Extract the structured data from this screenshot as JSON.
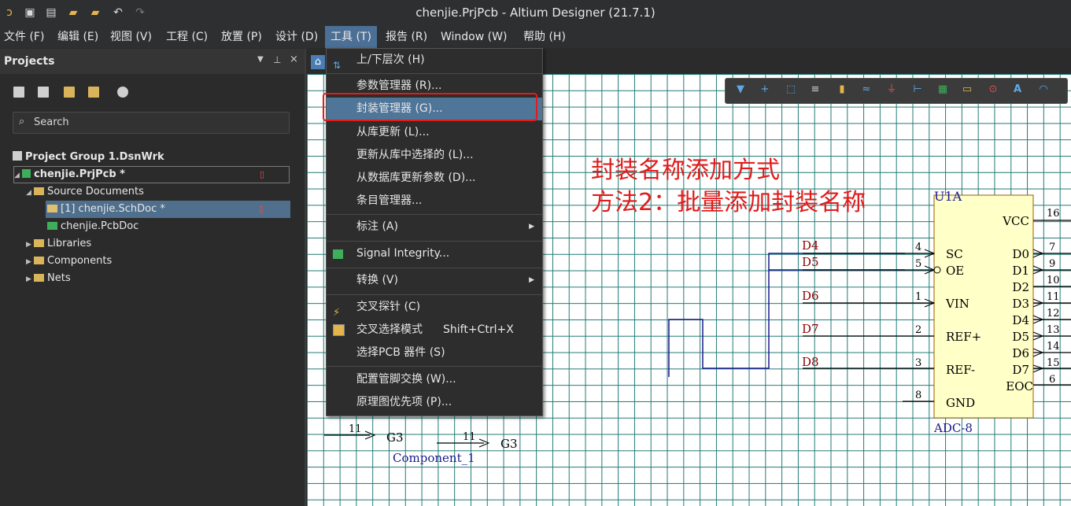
{
  "window": {
    "title": "chenjie.PrjPcb - Altium Designer (21.7.1)"
  },
  "menubar": {
    "items": [
      {
        "label": "文件 (F)"
      },
      {
        "label": "编辑 (E)"
      },
      {
        "label": "视图 (V)"
      },
      {
        "label": "工程 (C)"
      },
      {
        "label": "放置 (P)"
      },
      {
        "label": "设计 (D)"
      },
      {
        "label": "工具 (T)"
      },
      {
        "label": "报告 (R)"
      },
      {
        "label": "Window (W)"
      },
      {
        "label": "帮助 (H)"
      }
    ]
  },
  "panel": {
    "title": "Projects",
    "search_placeholder": "Search",
    "tree": {
      "group": "Project Group 1.DsnWrk",
      "project": "chenjie.PrjPcb *",
      "source_documents": "Source Documents",
      "schdoc": "[1] chenjie.SchDoc *",
      "pcbdoc": "chenjie.PcbDoc",
      "libraries": "Libraries",
      "components": "Components",
      "nets": "Nets"
    }
  },
  "tools_menu": {
    "items": [
      {
        "label": "上/下层次 (H)",
        "shortcut": ""
      },
      {
        "label": "参数管理器 (R)...",
        "shortcut": ""
      },
      {
        "label": "封装管理器 (G)...",
        "shortcut": ""
      },
      {
        "label": "从库更新 (L)...",
        "shortcut": ""
      },
      {
        "label": "更新从库中选择的 (L)...",
        "shortcut": ""
      },
      {
        "label": "从数据库更新参数 (D)...",
        "shortcut": ""
      },
      {
        "label": "条目管理器...",
        "shortcut": ""
      },
      {
        "label": "标注 (A)",
        "shortcut": ""
      },
      {
        "label": "Signal Integrity...",
        "shortcut": ""
      },
      {
        "label": "转换 (V)",
        "shortcut": ""
      },
      {
        "label": "交叉探针 (C)",
        "shortcut": ""
      },
      {
        "label": "交叉选择模式",
        "shortcut": "Shift+Ctrl+X"
      },
      {
        "label": "选择PCB 器件 (S)",
        "shortcut": ""
      },
      {
        "label": "配置管脚交换 (W)...",
        "shortcut": ""
      },
      {
        "label": "原理图优先项 (P)...",
        "shortcut": ""
      }
    ]
  },
  "annotation": {
    "line1": "封装名称添加方式",
    "line2": "方法2：批量添加封装名称"
  },
  "schematic": {
    "designator": "U1A",
    "comment": "ADC-8",
    "left_pins": [
      {
        "num": "4",
        "name": "SC",
        "net": "D4"
      },
      {
        "num": "5",
        "name": "OE",
        "net": "D5"
      },
      {
        "num": "1",
        "name": "VIN",
        "net": "D6"
      },
      {
        "num": "2",
        "name": "REF+",
        "net": "D7"
      },
      {
        "num": "3",
        "name": "REF-",
        "net": "D8"
      },
      {
        "num": "8",
        "name": "GND",
        "net": ""
      }
    ],
    "right_pins": [
      {
        "num": "16",
        "name": "VCC"
      },
      {
        "num": "7",
        "name": "D0"
      },
      {
        "num": "9",
        "name": "D1"
      },
      {
        "num": "10",
        "name": "D2"
      },
      {
        "num": "11",
        "name": "D3"
      },
      {
        "num": "12",
        "name": "D4"
      },
      {
        "num": "13",
        "name": "D5"
      },
      {
        "num": "14",
        "name": "D6"
      },
      {
        "num": "15",
        "name": "D7"
      },
      {
        "num": "6",
        "name": "EOC"
      }
    ],
    "bottom": {
      "pin_a_num": "11",
      "pin_a_name": "G3",
      "pin_b_num": "11",
      "pin_b_name": "G3",
      "component_label": "Component_1"
    }
  },
  "colors": {
    "accent": "#4f7599",
    "highlight_box": "#e21b1b",
    "grid": "#1f7a75",
    "wire": "#1a1a8c",
    "net": "#8b0000"
  }
}
